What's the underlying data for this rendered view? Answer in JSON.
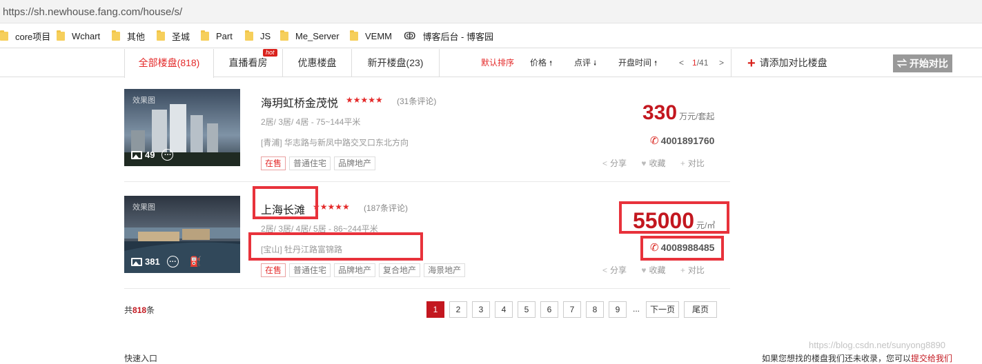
{
  "browser": {
    "url": "https://sh.newhouse.fang.com/house/s/",
    "bookmarks": [
      "core项目",
      "Wchart",
      "其他",
      "圣城",
      "Part",
      "JS",
      "Me_Server",
      "VEMM",
      "博客后台 - 博客园"
    ]
  },
  "tabs": [
    {
      "label": "全部楼盘(818)",
      "active": true
    },
    {
      "label": "直播看房",
      "badge": "hot"
    },
    {
      "label": "优惠楼盘"
    },
    {
      "label": "新开楼盘(23)"
    }
  ],
  "sort": {
    "default": "默认排序",
    "price": "价格",
    "rating": "点评",
    "open_time": "开盘时间",
    "prev": "<",
    "current_page": "1",
    "total_pages": "/41",
    "next": ">"
  },
  "compare": {
    "add_label": "请添加对比楼盘",
    "start_label": "⇌ 开始对比"
  },
  "listings": [
    {
      "photo_tag": "效果图",
      "photo_count": "49",
      "name": "海玥虹桥金茂悦",
      "stars": "★★★★★",
      "reviews": "(31条评论)",
      "rooms": "2居/ 3居/ 4居  -  75~144平米",
      "address": "[青浦] 华志路与新凤中路交叉口东北方向",
      "tags": [
        "在售",
        "普通住宅",
        "品牌地产"
      ],
      "price": "330",
      "price_unit": "万元/套起",
      "phone": "4001891760",
      "actions": {
        "share": "分享",
        "favorite": "收藏",
        "compare": "对比"
      }
    },
    {
      "photo_tag": "效果图",
      "photo_count": "381",
      "name": "上海长滩",
      "stars": "★★★★★",
      "reviews": "(187条评论)",
      "rooms": "2居/ 3居/ 4居/ 5居  -  86~244平米",
      "address": "[宝山] 牡丹江路富锦路",
      "tags": [
        "在售",
        "普通住宅",
        "品牌地产",
        "复合地产",
        "海景地产"
      ],
      "price": "55000",
      "price_unit": "元/㎡",
      "phone": "4008988485",
      "actions": {
        "share": "分享",
        "favorite": "收藏",
        "compare": "对比"
      }
    }
  ],
  "summary": {
    "prefix": "共",
    "count": "818",
    "suffix": "条"
  },
  "pagination": {
    "pages": [
      "1",
      "2",
      "3",
      "4",
      "5",
      "6",
      "7",
      "8",
      "9"
    ],
    "ellipsis": "...",
    "next": "下一页",
    "last": "尾页"
  },
  "footer": {
    "left": "快速入口",
    "right_text": "如果您想找的楼盘我们还未收录，您可以",
    "right_link": "提交给我们"
  },
  "watermark": "https://blog.csdn.net/sunyong8890",
  "colors": {
    "accent": "#c3171f",
    "highlight": "#e8323b",
    "tab_active": "#e42a2a"
  }
}
